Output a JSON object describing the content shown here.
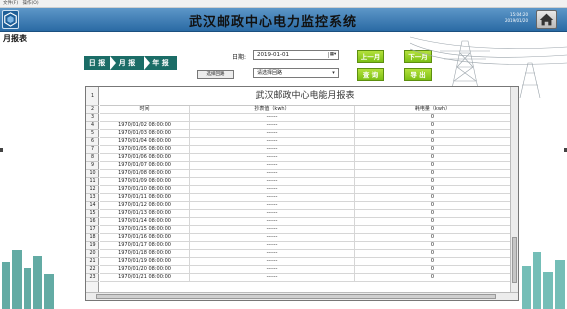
{
  "menubar": {
    "items": [
      "文件(F)",
      "操作(O)"
    ]
  },
  "header": {
    "title": "武汉邮政中心电力监控系统",
    "time": "15:04:20",
    "date": "2019/01/20"
  },
  "page": {
    "title": "月报表"
  },
  "tabs": [
    "日 报",
    "月 报",
    "年 报"
  ],
  "filters": {
    "date_label": "日期:",
    "date_value": "2019-01-01",
    "select_circuit_button": "选择回路",
    "circuit_value": "请选择回路"
  },
  "buttons": {
    "prev": "上一月",
    "next": "下一月",
    "query": "查 询",
    "export": "导 出"
  },
  "report": {
    "title": "武汉邮政中心电能月报表",
    "columns": [
      "时间",
      "抄表值（kwh）",
      "耗电量（kwh）"
    ],
    "row_numbers": [
      "1",
      "2",
      "3",
      "4",
      "5",
      "6",
      "7",
      "8",
      "9",
      "10",
      "11",
      "12",
      "13",
      "14",
      "15",
      "16",
      "17",
      "18",
      "19",
      "20",
      "21",
      "22",
      "23"
    ],
    "rows": [
      [
        "",
        "------",
        "0"
      ],
      [
        "1970/01/02 08:00:00",
        "------",
        "0"
      ],
      [
        "1970/01/03 08:00:00",
        "------",
        "0"
      ],
      [
        "1970/01/04 08:00:00",
        "------",
        "0"
      ],
      [
        "1970/01/05 08:00:00",
        "------",
        "0"
      ],
      [
        "1970/01/06 08:00:00",
        "------",
        "0"
      ],
      [
        "1970/01/07 08:00:00",
        "------",
        "0"
      ],
      [
        "1970/01/08 08:00:00",
        "------",
        "0"
      ],
      [
        "1970/01/09 08:00:00",
        "------",
        "0"
      ],
      [
        "1970/01/10 08:00:00",
        "------",
        "0"
      ],
      [
        "1970/01/11 08:00:00",
        "------",
        "0"
      ],
      [
        "1970/01/12 08:00:00",
        "------",
        "0"
      ],
      [
        "1970/01/13 08:00:00",
        "------",
        "0"
      ],
      [
        "1970/01/14 08:00:00",
        "------",
        "0"
      ],
      [
        "1970/01/15 08:00:00",
        "------",
        "0"
      ],
      [
        "1970/01/16 08:00:00",
        "------",
        "0"
      ],
      [
        "1970/01/17 08:00:00",
        "------",
        "0"
      ],
      [
        "1970/01/18 08:00:00",
        "------",
        "0"
      ],
      [
        "1970/01/19 08:00:00",
        "------",
        "0"
      ],
      [
        "1970/01/20 08:00:00",
        "------",
        "0"
      ],
      [
        "1970/01/21 08:00:00",
        "------",
        "0"
      ]
    ]
  },
  "icons": {
    "logo": "hexagon-logo-icon",
    "home": "home-icon",
    "calendar": "calendar-icon",
    "dropdown": "chevron-down-icon"
  },
  "colors": {
    "header": "#2a6aa4",
    "tab": "#1b6d67",
    "green_button": "#7cbf14"
  }
}
